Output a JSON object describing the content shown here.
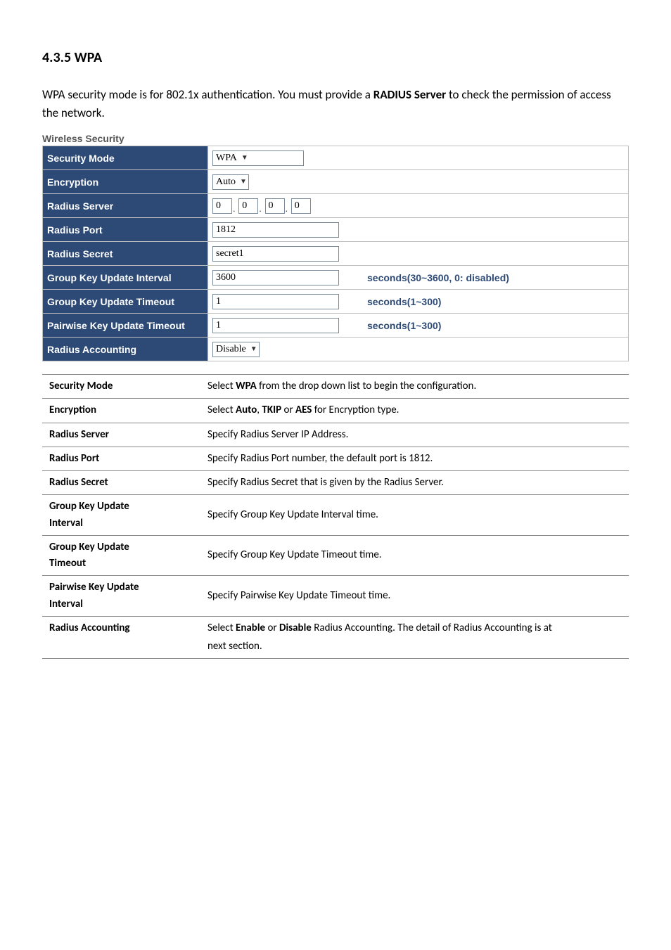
{
  "section_title": "4.3.5 WPA",
  "intro": {
    "pre": "WPA security mode is for 802.1x authentication. You must provide a ",
    "bold": "RADIUS Server",
    "post": " to check the permission of access the network."
  },
  "panel_title": "Wireless Security",
  "config": {
    "rows": [
      {
        "label": "Security Mode",
        "type": "select",
        "value": "WPA",
        "width": "w-wide"
      },
      {
        "label": "Encryption",
        "type": "select",
        "value": "Auto",
        "width": ""
      },
      {
        "label": "Radius Server",
        "type": "ip",
        "o1": "0",
        "o2": "0",
        "o3": "0",
        "o4": "0"
      },
      {
        "label": "Radius Port",
        "type": "input",
        "value": "1812",
        "width": "w-med"
      },
      {
        "label": "Radius Secret",
        "type": "input",
        "value": "secret1",
        "width": "w-med"
      },
      {
        "label": "Group Key Update Interval",
        "type": "input-hint",
        "value": "3600",
        "hint": "seconds(30~3600, 0: disabled)"
      },
      {
        "label": "Group Key Update Timeout",
        "type": "input-hint",
        "value": "1",
        "hint": "seconds(1~300)"
      },
      {
        "label": "Pairwise Key Update Timeout",
        "type": "input-hint",
        "value": "1",
        "hint": "seconds(1~300)"
      },
      {
        "label": "Radius Accounting",
        "type": "select",
        "value": "Disable",
        "width": ""
      }
    ]
  },
  "desc": {
    "rows": [
      {
        "term": "Security Mode",
        "pre": "Select ",
        "b1": "WPA",
        "post": " from the drop down list to begin the configuration."
      },
      {
        "term": "Encryption",
        "pre": "Select ",
        "b1": "Auto",
        "mid1": ", ",
        "b2": "TKIP",
        "mid2": " or ",
        "b3": "AES",
        "post": " for Encryption type."
      },
      {
        "term": "Radius Server",
        "plain": "Specify Radius Server IP Address."
      },
      {
        "term": "Radius Port",
        "plain": "Specify Radius Port number, the default port is 1812."
      },
      {
        "term": "Radius Secret",
        "plain": "Specify Radius Secret that is given by the Radius Server."
      },
      {
        "term": "Group Key Update Interval",
        "plain": "Specify Group Key Update Interval time.",
        "twoLine": true,
        "line2": "Interval",
        "line1": "Group Key Update"
      },
      {
        "term": "Group Key Update Timeout",
        "plain": "Specify Group Key Update Timeout time.",
        "twoLine": true,
        "line2": "Timeout",
        "line1": "Group Key Update"
      },
      {
        "term": "Pairwise Key Update Interval",
        "plain": "Specify Pairwise Key Update Timeout time.",
        "twoLine": true,
        "line2": "Interval",
        "line1": "Pairwise Key Update"
      },
      {
        "term": "Radius Accounting",
        "pre": "Select ",
        "b1": "Enable",
        "mid1": " or ",
        "b2": "Disable",
        "post": " Radius Accounting. The detail of Radius Accounting is at",
        "extra": "next section."
      }
    ]
  }
}
